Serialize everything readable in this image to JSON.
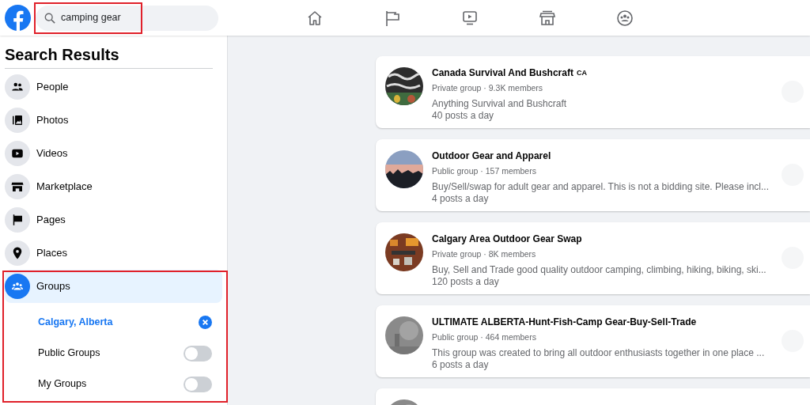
{
  "search": {
    "value": "camping gear",
    "highlighted": true
  },
  "nav": [
    {
      "kind": "home",
      "selected": false
    },
    {
      "kind": "flag",
      "selected": false
    },
    {
      "kind": "video",
      "selected": false
    },
    {
      "kind": "store",
      "selected": false
    },
    {
      "kind": "groups",
      "selected": false
    }
  ],
  "sidebar": {
    "title": "Search Results",
    "items": [
      {
        "kind": "people",
        "label": "People",
        "selected": false
      },
      {
        "kind": "photos",
        "label": "Photos",
        "selected": false
      },
      {
        "kind": "videos",
        "label": "Videos",
        "selected": false
      },
      {
        "kind": "marketplace",
        "label": "Marketplace",
        "selected": false
      },
      {
        "kind": "pages",
        "label": "Pages",
        "selected": false
      },
      {
        "kind": "places",
        "label": "Places",
        "selected": false
      },
      {
        "kind": "groups",
        "label": "Groups",
        "selected": true
      }
    ],
    "filters_highlighted": true,
    "filters": [
      {
        "kind": "location",
        "label": "Calgary, Alberta"
      },
      {
        "kind": "toggle",
        "label": "Public Groups",
        "on": false
      },
      {
        "kind": "toggle",
        "label": "My Groups",
        "on": false
      }
    ]
  },
  "results": [
    {
      "title": "Canada Survival And Bushcraft",
      "badge": "CA",
      "meta": "Private group · 9.3K members",
      "description": "Anything Survival and Bushcraft",
      "activity": "40 posts a day",
      "kind": "picture"
    },
    {
      "title": "Outdoor Gear and Apparel",
      "meta": "Public group · 157 members",
      "description": "Buy/Sell/swap for adult gear and apparel. This is not a bidding site. Please incl...",
      "activity": "4 posts a day",
      "kind": "picture"
    },
    {
      "title": "Calgary Area Outdoor Gear Swap",
      "meta": "Private group · 8K members",
      "description": "Buy, Sell and Trade good quality outdoor camping, climbing, hiking, biking, ski...",
      "activity": "120 posts a day",
      "kind": "picture"
    },
    {
      "title": "ULTIMATE ALBERTA-Hunt-Fish-Camp Gear-Buy-Sell-Trade",
      "meta": "Public group · 464 members",
      "description": "This group was created to bring all outdoor enthusiasts together in one place ...",
      "activity": "6 posts a day",
      "kind": "picture"
    },
    {
      "kind": "picture"
    }
  ]
}
